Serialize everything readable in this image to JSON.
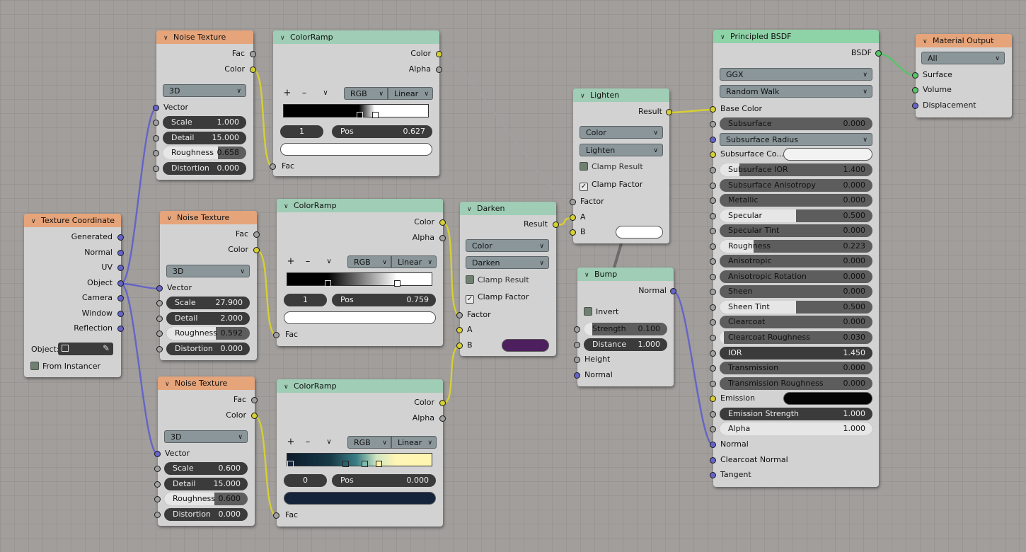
{
  "nodes": {
    "noise1": {
      "title": "Noise Texture",
      "out_fac": "Fac",
      "out_color": "Color",
      "dimension": "3D",
      "vector": "Vector",
      "scale_label": "Scale",
      "scale": "1.000",
      "detail_label": "Detail",
      "detail": "15.000",
      "roughness_label": "Roughness",
      "roughness": "0.658",
      "roughness_frac": 0.658,
      "distortion_label": "Distortion",
      "distortion": "0.000"
    },
    "noise2": {
      "title": "Noise Texture",
      "out_fac": "Fac",
      "out_color": "Color",
      "dimension": "3D",
      "vector": "Vector",
      "scale_label": "Scale",
      "scale": "27.900",
      "detail_label": "Detail",
      "detail": "2.000",
      "roughness_label": "Roughness",
      "roughness": "0.592",
      "roughness_frac": 0.592,
      "distortion_label": "Distortion",
      "distortion": "0.000"
    },
    "noise3": {
      "title": "Noise Texture",
      "out_fac": "Fac",
      "out_color": "Color",
      "dimension": "3D",
      "vector": "Vector",
      "scale_label": "Scale",
      "scale": "0.600",
      "detail_label": "Detail",
      "detail": "15.000",
      "roughness_label": "Roughness",
      "roughness": "0.600",
      "roughness_frac": 0.6,
      "distortion_label": "Distortion",
      "distortion": "0.000"
    },
    "ramp1": {
      "title": "ColorRamp",
      "out_color": "Color",
      "out_alpha": "Alpha",
      "plus": "+",
      "minus": "–",
      "mode": "RGB",
      "interp": "Linear",
      "index": "1",
      "pos_label": "Pos",
      "pos": "0.627",
      "in_fac": "Fac",
      "color": "#ffffff"
    },
    "ramp2": {
      "title": "ColorRamp",
      "out_color": "Color",
      "out_alpha": "Alpha",
      "plus": "+",
      "minus": "–",
      "mode": "RGB",
      "interp": "Linear",
      "index": "1",
      "pos_label": "Pos",
      "pos": "0.759",
      "in_fac": "Fac",
      "color": "#ffffff"
    },
    "ramp3": {
      "title": "ColorRamp",
      "out_color": "Color",
      "out_alpha": "Alpha",
      "plus": "+",
      "minus": "–",
      "mode": "RGB",
      "interp": "Linear",
      "index": "0",
      "pos_label": "Pos",
      "pos": "0.000",
      "in_fac": "Fac",
      "color": "#15243a"
    },
    "texcoord": {
      "title": "Texture Coordinate",
      "outputs": [
        "Generated",
        "Normal",
        "UV",
        "Object",
        "Camera",
        "Window",
        "Reflection"
      ],
      "object_label": "Object:",
      "from_instancer": "From Instancer"
    },
    "darken": {
      "title": "Darken",
      "out_result": "Result",
      "mode1": "Color",
      "mode2": "Darken",
      "clamp_result": "Clamp Result",
      "clamp_factor": "Clamp Factor",
      "in_factor": "Factor",
      "in_a": "A",
      "in_b": "B",
      "b_color": "#4e1f5e"
    },
    "lighten": {
      "title": "Lighten",
      "out_result": "Result",
      "mode1": "Color",
      "mode2": "Lighten",
      "clamp_result": "Clamp Result",
      "clamp_factor": "Clamp Factor",
      "in_factor": "Factor",
      "in_a": "A",
      "in_b": "B",
      "b_color": "#ffffff"
    },
    "bump": {
      "title": "Bump",
      "out_normal": "Normal",
      "invert": "Invert",
      "strength_label": "Strength",
      "strength": "0.100",
      "distance_label": "Distance",
      "distance": "1.000",
      "in_height": "Height",
      "in_normal": "Normal"
    },
    "bsdf": {
      "title": "Principled BSDF",
      "out": "BSDF",
      "distribution": "GGX",
      "subsurface_method": "Random Walk",
      "base_color": "Base Color",
      "subsurface_label": "Subsurface",
      "subsurface": "0.000",
      "subsurface_radius": "Subsurface Radius",
      "subsurface_color": "Subsurface Co...",
      "subsurface_ior_label": "Subsurface IOR",
      "subsurface_ior": "1.400",
      "subsurface_aniso_label": "Subsurface Anisotropy",
      "subsurface_aniso": "0.000",
      "metallic_label": "Metallic",
      "metallic": "0.000",
      "specular_label": "Specular",
      "specular": "0.500",
      "specular_tint_label": "Specular Tint",
      "specular_tint": "0.000",
      "roughness_label": "Roughness",
      "roughness": "0.223",
      "anisotropic_label": "Anisotropic",
      "anisotropic": "0.000",
      "aniso_rot_label": "Anisotropic Rotation",
      "aniso_rot": "0.000",
      "sheen_label": "Sheen",
      "sheen": "0.000",
      "sheen_tint_label": "Sheen Tint",
      "sheen_tint": "0.500",
      "clearcoat_label": "Clearcoat",
      "clearcoat": "0.000",
      "clearcoat_rough_label": "Clearcoat Roughness",
      "clearcoat_rough": "0.030",
      "ior_label": "IOR",
      "ior": "1.450",
      "transmission_label": "Transmission",
      "transmission": "0.000",
      "trans_rough_label": "Transmission Roughness",
      "trans_rough": "0.000",
      "emission": "Emission",
      "emission_color": "#050505",
      "emission_strength_label": "Emission Strength",
      "emission_strength": "1.000",
      "alpha_label": "Alpha",
      "alpha": "1.000",
      "normal": "Normal",
      "clearcoat_normal": "Clearcoat Normal",
      "tangent": "Tangent"
    },
    "output": {
      "title": "Material Output",
      "target": "All",
      "surface": "Surface",
      "volume": "Volume",
      "displacement": "Displacement"
    }
  },
  "socket_colors": {
    "color": "#d6cf33",
    "float": "#a0a0a0",
    "vector": "#6464c8",
    "shader": "#58c468"
  },
  "header_colors": {
    "texture": "#e6a47a",
    "converter": "#9fcdb5",
    "shader": "#8ed2a7"
  }
}
